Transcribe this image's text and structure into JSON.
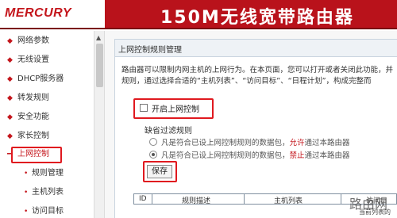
{
  "header": {
    "logo": "MERCURY",
    "title": "150M无线宽带路由器"
  },
  "sidebar": {
    "items": [
      {
        "label": "网络参数"
      },
      {
        "label": "无线设置"
      },
      {
        "label": "DHCP服务器"
      },
      {
        "label": "转发规则"
      },
      {
        "label": "安全功能"
      },
      {
        "label": "家长控制"
      },
      {
        "label": "上网控制"
      }
    ],
    "sub_items": [
      {
        "label": "规则管理"
      },
      {
        "label": "主机列表"
      },
      {
        "label": "访问目标"
      }
    ]
  },
  "panel": {
    "title": "上网控制规则管理",
    "desc_line1": "路由器可以限制内网主机的上网行为。在本页面，您可以打开或者关闭此功能，并",
    "desc_line2": "规则，通过选择合适的“主机列表”、“访问目标”、“日程计划”，构成完整而",
    "enable_label": "开启上网控制",
    "default_rule_label": "缺省过滤规则",
    "radio1_prefix": "凡是符合已设上网控制规则的数据包，",
    "radio1_highlight": "允许",
    "radio1_suffix": "通过本路由器",
    "radio2_prefix": "凡是符合已设上网控制规则的数据包，",
    "radio2_highlight": "禁止",
    "radio2_suffix": "通过本路由器",
    "save_label": "保存"
  },
  "table": {
    "headers": [
      "ID",
      "规则描述",
      "主机列表",
      "访问目"
    ]
  },
  "watermark": {
    "main": "路由网",
    "sub": "当前列表的"
  },
  "colors": {
    "brand_red": "#b9121b",
    "highlight_box": "#e0191f"
  }
}
